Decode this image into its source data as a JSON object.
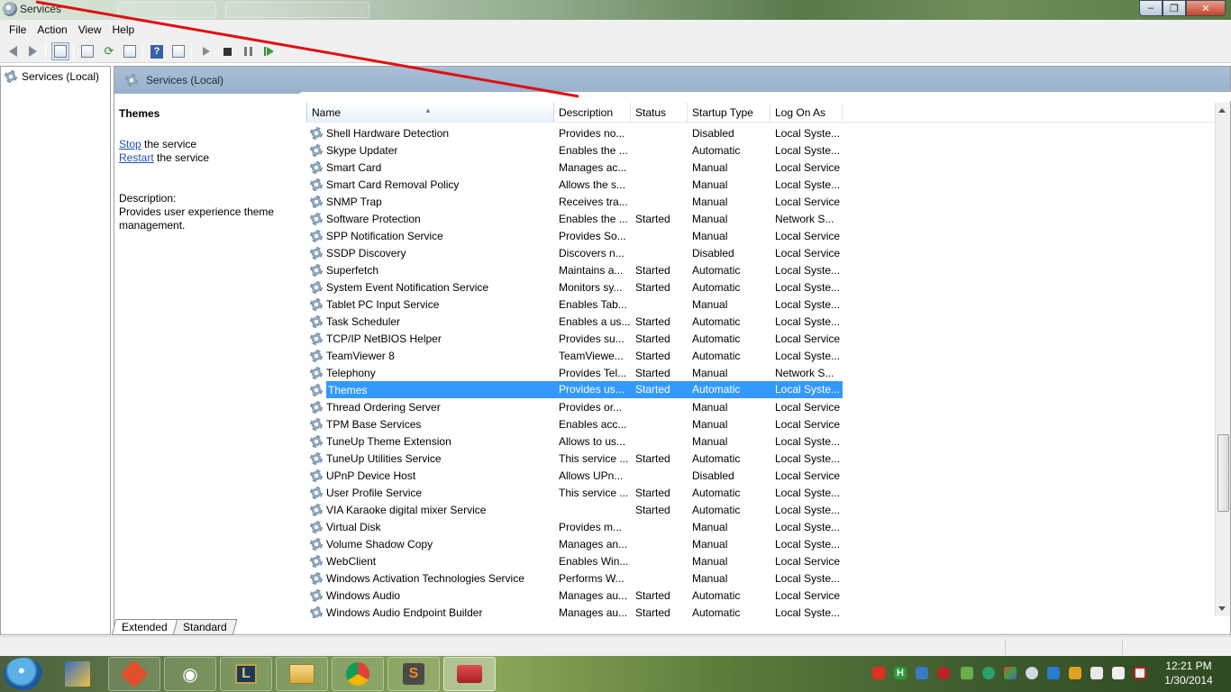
{
  "window": {
    "title": "Services"
  },
  "menu": {
    "file": "File",
    "action": "Action",
    "view": "View",
    "help": "Help"
  },
  "toolbar": {
    "icons": [
      "back-arrow-icon",
      "forward-arrow-icon",
      "show-hide-console-tree-icon",
      "properties-icon",
      "refresh-icon",
      "export-list-icon",
      "help-icon",
      "action-pane-icon",
      "start-service-icon",
      "stop-service-icon",
      "pause-service-icon",
      "restart-service-icon"
    ]
  },
  "tree": {
    "root_label": "Services (Local)"
  },
  "content": {
    "header_title": "Services (Local)",
    "detail": {
      "title": "Themes",
      "stop_link": "Stop",
      "stop_suffix": " the service",
      "restart_link": "Restart",
      "restart_suffix": " the service",
      "description_label": "Description:",
      "description_text": "Provides user experience theme management."
    },
    "columns": [
      "Name",
      "Description",
      "Status",
      "Startup Type",
      "Log On As"
    ],
    "rows": [
      {
        "name": "Shell Hardware Detection",
        "desc": "Provides no...",
        "status": "",
        "startup": "Disabled",
        "logon": "Local Syste..."
      },
      {
        "name": "Skype Updater",
        "desc": "Enables the ...",
        "status": "",
        "startup": "Automatic",
        "logon": "Local Syste..."
      },
      {
        "name": "Smart Card",
        "desc": "Manages ac...",
        "status": "",
        "startup": "Manual",
        "logon": "Local Service"
      },
      {
        "name": "Smart Card Removal Policy",
        "desc": "Allows the s...",
        "status": "",
        "startup": "Manual",
        "logon": "Local Syste..."
      },
      {
        "name": "SNMP Trap",
        "desc": "Receives tra...",
        "status": "",
        "startup": "Manual",
        "logon": "Local Service"
      },
      {
        "name": "Software Protection",
        "desc": "Enables the ...",
        "status": "Started",
        "startup": "Manual",
        "logon": "Network S..."
      },
      {
        "name": "SPP Notification Service",
        "desc": "Provides So...",
        "status": "",
        "startup": "Manual",
        "logon": "Local Service"
      },
      {
        "name": "SSDP Discovery",
        "desc": "Discovers n...",
        "status": "",
        "startup": "Disabled",
        "logon": "Local Service"
      },
      {
        "name": "Superfetch",
        "desc": "Maintains a...",
        "status": "Started",
        "startup": "Automatic",
        "logon": "Local Syste..."
      },
      {
        "name": "System Event Notification Service",
        "desc": "Monitors sy...",
        "status": "Started",
        "startup": "Automatic",
        "logon": "Local Syste..."
      },
      {
        "name": "Tablet PC Input Service",
        "desc": "Enables Tab...",
        "status": "",
        "startup": "Manual",
        "logon": "Local Syste..."
      },
      {
        "name": "Task Scheduler",
        "desc": "Enables a us...",
        "status": "Started",
        "startup": "Automatic",
        "logon": "Local Syste..."
      },
      {
        "name": "TCP/IP NetBIOS Helper",
        "desc": "Provides su...",
        "status": "Started",
        "startup": "Automatic",
        "logon": "Local Service"
      },
      {
        "name": "TeamViewer 8",
        "desc": "TeamViewe...",
        "status": "Started",
        "startup": "Automatic",
        "logon": "Local Syste..."
      },
      {
        "name": "Telephony",
        "desc": "Provides Tel...",
        "status": "Started",
        "startup": "Manual",
        "logon": "Network S..."
      },
      {
        "name": "Themes",
        "desc": "Provides us...",
        "status": "Started",
        "startup": "Automatic",
        "logon": "Local Syste...",
        "selected": true
      },
      {
        "name": "Thread Ordering Server",
        "desc": "Provides or...",
        "status": "",
        "startup": "Manual",
        "logon": "Local Service"
      },
      {
        "name": "TPM Base Services",
        "desc": "Enables acc...",
        "status": "",
        "startup": "Manual",
        "logon": "Local Service"
      },
      {
        "name": "TuneUp Theme Extension",
        "desc": "Allows to us...",
        "status": "",
        "startup": "Manual",
        "logon": "Local Syste..."
      },
      {
        "name": "TuneUp Utilities Service",
        "desc": "This service ...",
        "status": "Started",
        "startup": "Automatic",
        "logon": "Local Syste..."
      },
      {
        "name": "UPnP Device Host",
        "desc": "Allows UPn...",
        "status": "",
        "startup": "Disabled",
        "logon": "Local Service"
      },
      {
        "name": "User Profile Service",
        "desc": "This service ...",
        "status": "Started",
        "startup": "Automatic",
        "logon": "Local Syste..."
      },
      {
        "name": "VIA Karaoke digital mixer Service",
        "desc": "",
        "status": "Started",
        "startup": "Automatic",
        "logon": "Local Syste..."
      },
      {
        "name": "Virtual Disk",
        "desc": "Provides m...",
        "status": "",
        "startup": "Manual",
        "logon": "Local Syste..."
      },
      {
        "name": "Volume Shadow Copy",
        "desc": "Manages an...",
        "status": "",
        "startup": "Manual",
        "logon": "Local Syste..."
      },
      {
        "name": "WebClient",
        "desc": "Enables Win...",
        "status": "",
        "startup": "Manual",
        "logon": "Local Service"
      },
      {
        "name": "Windows Activation Technologies Service",
        "desc": "Performs W...",
        "status": "",
        "startup": "Manual",
        "logon": "Local Syste..."
      },
      {
        "name": "Windows Audio",
        "desc": "Manages au...",
        "status": "Started",
        "startup": "Automatic",
        "logon": "Local Service"
      },
      {
        "name": "Windows Audio Endpoint Builder",
        "desc": "Manages au...",
        "status": "Started",
        "startup": "Automatic",
        "logon": "Local Syste..."
      }
    ],
    "selected_row_color": "#3399ff"
  },
  "tabs": {
    "extended": "Extended",
    "standard": "Standard"
  },
  "taskbar": {
    "apps": [
      "git-icon",
      "foobar-icon",
      "league-of-legends-icon",
      "file-explorer-icon",
      "chrome-icon",
      "sublime-text-icon",
      "toolbox-icon"
    ],
    "app_letters": {
      "git": "",
      "league": "L",
      "sublime": "S"
    },
    "clock_time": "12:21 PM",
    "clock_date": "1/30/2014"
  },
  "annotation": {
    "color": "#e01010"
  }
}
